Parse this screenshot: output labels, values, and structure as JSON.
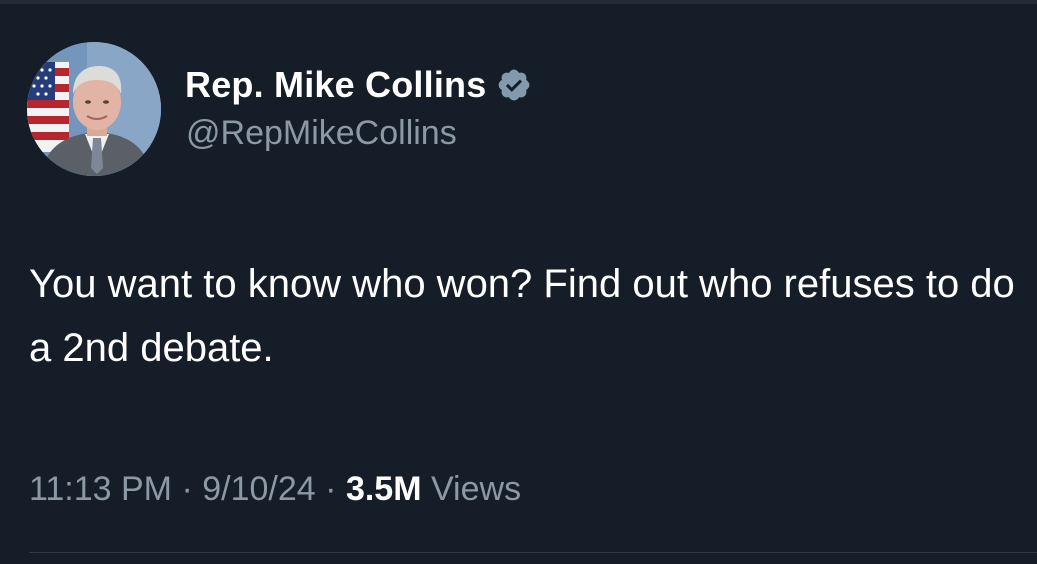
{
  "tweet": {
    "author": {
      "display_name": "Rep. Mike Collins",
      "handle": "@RepMikeCollins",
      "verified": true,
      "verified_badge_color": "#829aab"
    },
    "text": "You want to know who won? Find out who refuses to do a 2nd debate.",
    "meta": {
      "time": "11:13 PM",
      "separator": "·",
      "date": "9/10/24",
      "views_count": "3.5M",
      "views_label": "Views"
    }
  },
  "colors": {
    "background": "#151d28",
    "primary_text": "#ffffff",
    "secondary_text": "#8b98a5",
    "divider": "#2f3844"
  }
}
